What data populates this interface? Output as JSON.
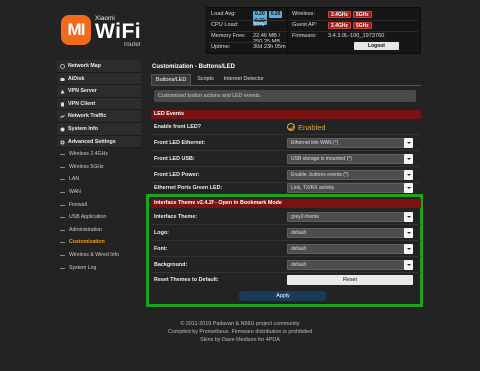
{
  "logo": {
    "mark": "MI",
    "brand": "Xiaomi",
    "wifi": "WiFi",
    "router": "router"
  },
  "status_left": {
    "load_avg_label": "Load Avg:",
    "load_avg": [
      "0.20",
      "0.20",
      "0.22"
    ],
    "cpu_label": "CPU Load:",
    "cpu": "30%",
    "mem_label": "Memory Free:",
    "mem": "22.46 MB / 250.25 MB",
    "uptime_label": "Uptime:",
    "uptime": "30d 23h 05m"
  },
  "status_right": {
    "wireless_label": "Wireless:",
    "wireless": [
      "2.4GHz",
      "5GHz"
    ],
    "guest_label": "Guest AP:",
    "guest": [
      "2.4GHz",
      "5GHz"
    ],
    "firmware_label": "Firmware:",
    "firmware": "3.4.3.9L-100_1973760",
    "logout": "Logout"
  },
  "sidebar": {
    "items": [
      {
        "label": "Network Map",
        "icon": "map-icon"
      },
      {
        "label": "AiDisk",
        "icon": "disk-icon"
      },
      {
        "label": "VPN Server",
        "icon": "server-icon"
      },
      {
        "label": "VPN Client",
        "icon": "client-icon"
      },
      {
        "label": "Network Traffic",
        "icon": "traffic-icon"
      },
      {
        "label": "System Info",
        "icon": "info-icon"
      },
      {
        "label": "Advanced Settings",
        "icon": "gear-icon"
      }
    ],
    "sub": [
      "Wireless 2.4GHz",
      "Wireless 5GHz",
      "LAN",
      "WAN",
      "Firewall",
      "USB Application",
      "Administration",
      "Customization",
      "Wireless & Wired Info",
      "System Log"
    ]
  },
  "main": {
    "title": "Customization - Buttons/LED",
    "tabs": [
      "Buttons/LED",
      "Scripts",
      "Internet Detector"
    ],
    "info": "Customized button actions and LED events."
  },
  "led": {
    "header": "LED Events",
    "enable_label": "Enable front LED?",
    "enable_value": "Enabled",
    "ethernet_label": "Front LED Ethernet:",
    "ethernet_value": "Ethernet link WAN (*)",
    "usb_label": "Front LED USB:",
    "usb_value": "USB storage is mounted (*)",
    "power_label": "Front LED Power:",
    "power_value": "Enable, buttons events (*)",
    "ports_label": "Ethernet Ports Green LED:",
    "ports_value": "Link, TX/RX activity"
  },
  "theme": {
    "header": "Interface Theme v2.4.2f - Open in Bookmark Mode",
    "theme_label": "Interface Theme:",
    "theme_value": "grey2-theme",
    "logo_label": "Logo:",
    "logo_value": "default",
    "font_label": "Font:",
    "font_value": "default",
    "bg_label": "Background:",
    "bg_value": "default",
    "reset_label": "Reset Themes to Default:",
    "reset_btn": "Reset",
    "apply": "Apply"
  },
  "footer": {
    "line1": "© 2011-2019 Padavan & N56U project community",
    "line2": "Compiled by Prometheus. Firmware distribution is prohibited",
    "line3": "Skins by Dave Medison for 4PDA"
  },
  "colors": {
    "accent": "#f26a1b",
    "section": "#7a1212",
    "highlight": "#1fa31f",
    "active": "#f39c12"
  }
}
